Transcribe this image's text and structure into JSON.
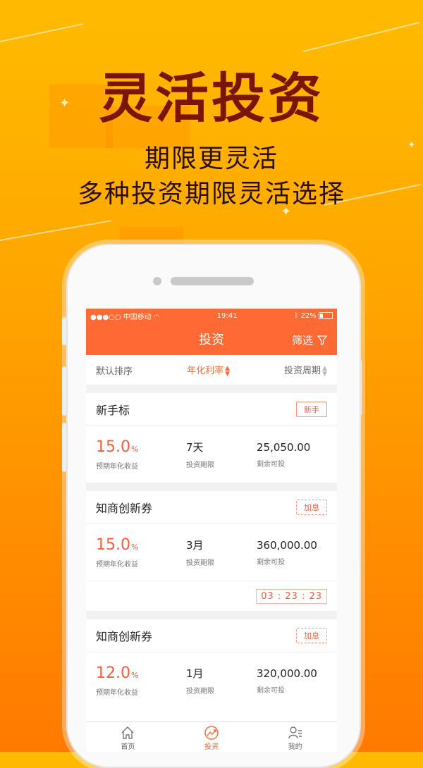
{
  "promo": {
    "headline": "灵活投资",
    "subline1": "期限更灵活",
    "subline2": "多种投资期限灵活选择"
  },
  "status_bar": {
    "carrier": "●●●○○ 中国移动",
    "time": "19:41",
    "battery": "22%"
  },
  "nav": {
    "title": "投资",
    "filter_label": "筛选"
  },
  "sort": {
    "default": "默认排序",
    "rate": "年化利率",
    "period": "投资周期"
  },
  "products": [
    {
      "title": "新手标",
      "tag": "新手",
      "rate": "15.0",
      "rate_unit": "%",
      "rate_label": "预期年化收益",
      "period": "7天",
      "period_label": "投资期限",
      "remaining": "25,050.00",
      "remaining_label": "剩余可投"
    },
    {
      "title": "知商创新券",
      "tag": "加息",
      "rate": "15.0",
      "rate_unit": "%",
      "rate_label": "预期年化收益",
      "period": "3月",
      "period_label": "投资期限",
      "remaining": "360,000.00",
      "remaining_label": "剩余可投",
      "countdown": "03 : 23 : 23"
    },
    {
      "title": "知商创新券",
      "tag": "加息",
      "rate": "12.0",
      "rate_unit": "%",
      "rate_label": "预期年化收益",
      "period": "1月",
      "period_label": "投资期限",
      "remaining": "320,000.00",
      "remaining_label": "剩余可投"
    }
  ],
  "tabbar": {
    "home": "首页",
    "invest": "投资",
    "mine": "我的"
  },
  "colors": {
    "accent": "#ff6a34",
    "headline": "#7a1405"
  }
}
